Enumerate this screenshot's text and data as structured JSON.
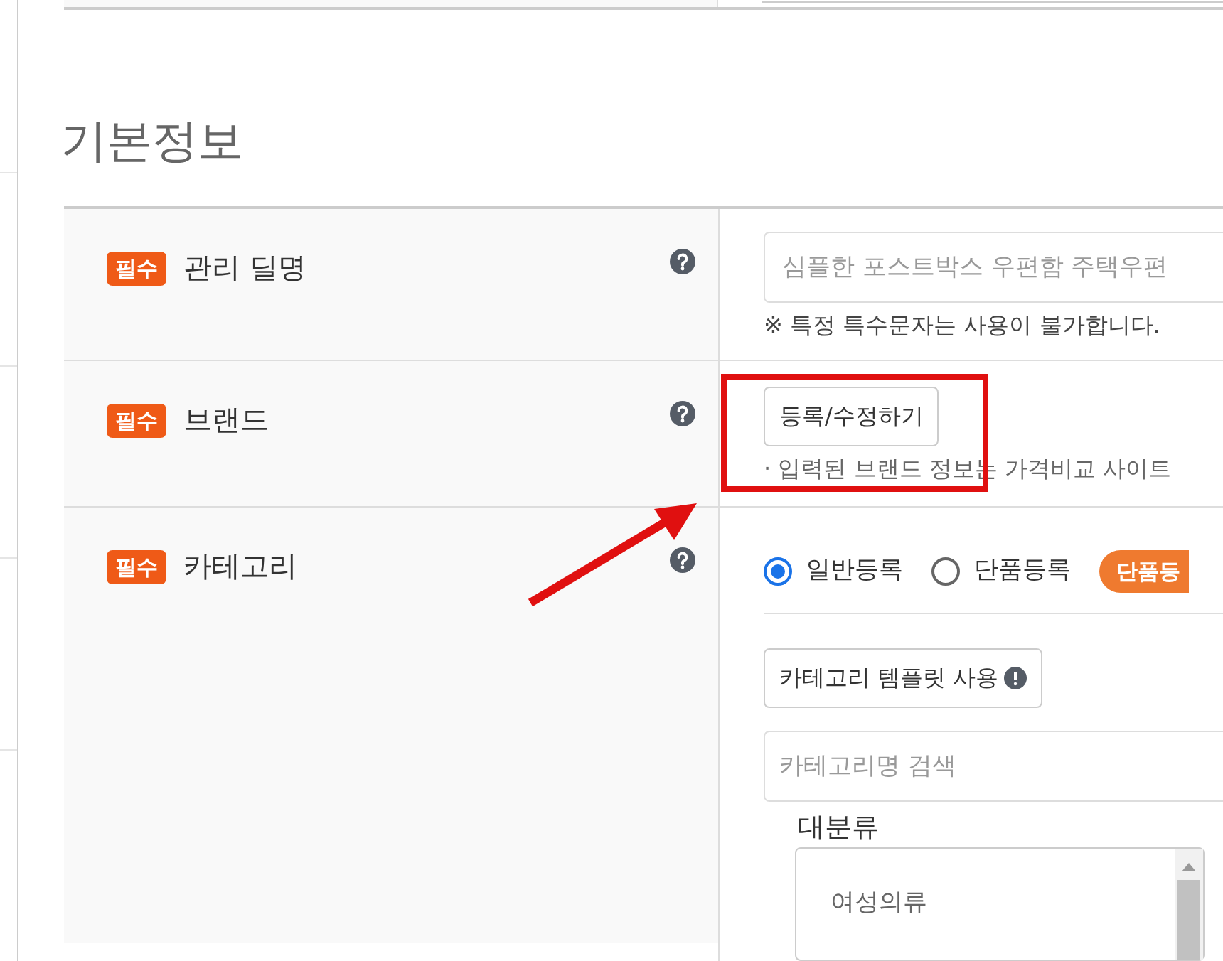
{
  "section_title": "기본정보",
  "rows": [
    {
      "kind": "text_input",
      "badge": "필수",
      "label": "관리 딜명",
      "placeholder": "심플한 포스트박스 우편함 주택우편",
      "note": "※ 특정 특수문자는 사용이 불가합니다."
    },
    {
      "kind": "brand",
      "badge": "필수",
      "label": "브랜드",
      "button": "등록/수정하기",
      "note": "· 입력된 브랜드 정보는 가격비교 사이트"
    },
    {
      "kind": "category",
      "badge": "필수",
      "label": "카테고리",
      "radios": [
        {
          "label": "일반등록",
          "selected": true
        },
        {
          "label": "단품등록",
          "selected": false
        }
      ],
      "pill": "단품등",
      "template_button": "카테고리 템플릿 사용",
      "search_placeholder": "카테고리명 검색",
      "list_label": "대분류",
      "list_items": [
        "여성의류"
      ]
    }
  ]
}
